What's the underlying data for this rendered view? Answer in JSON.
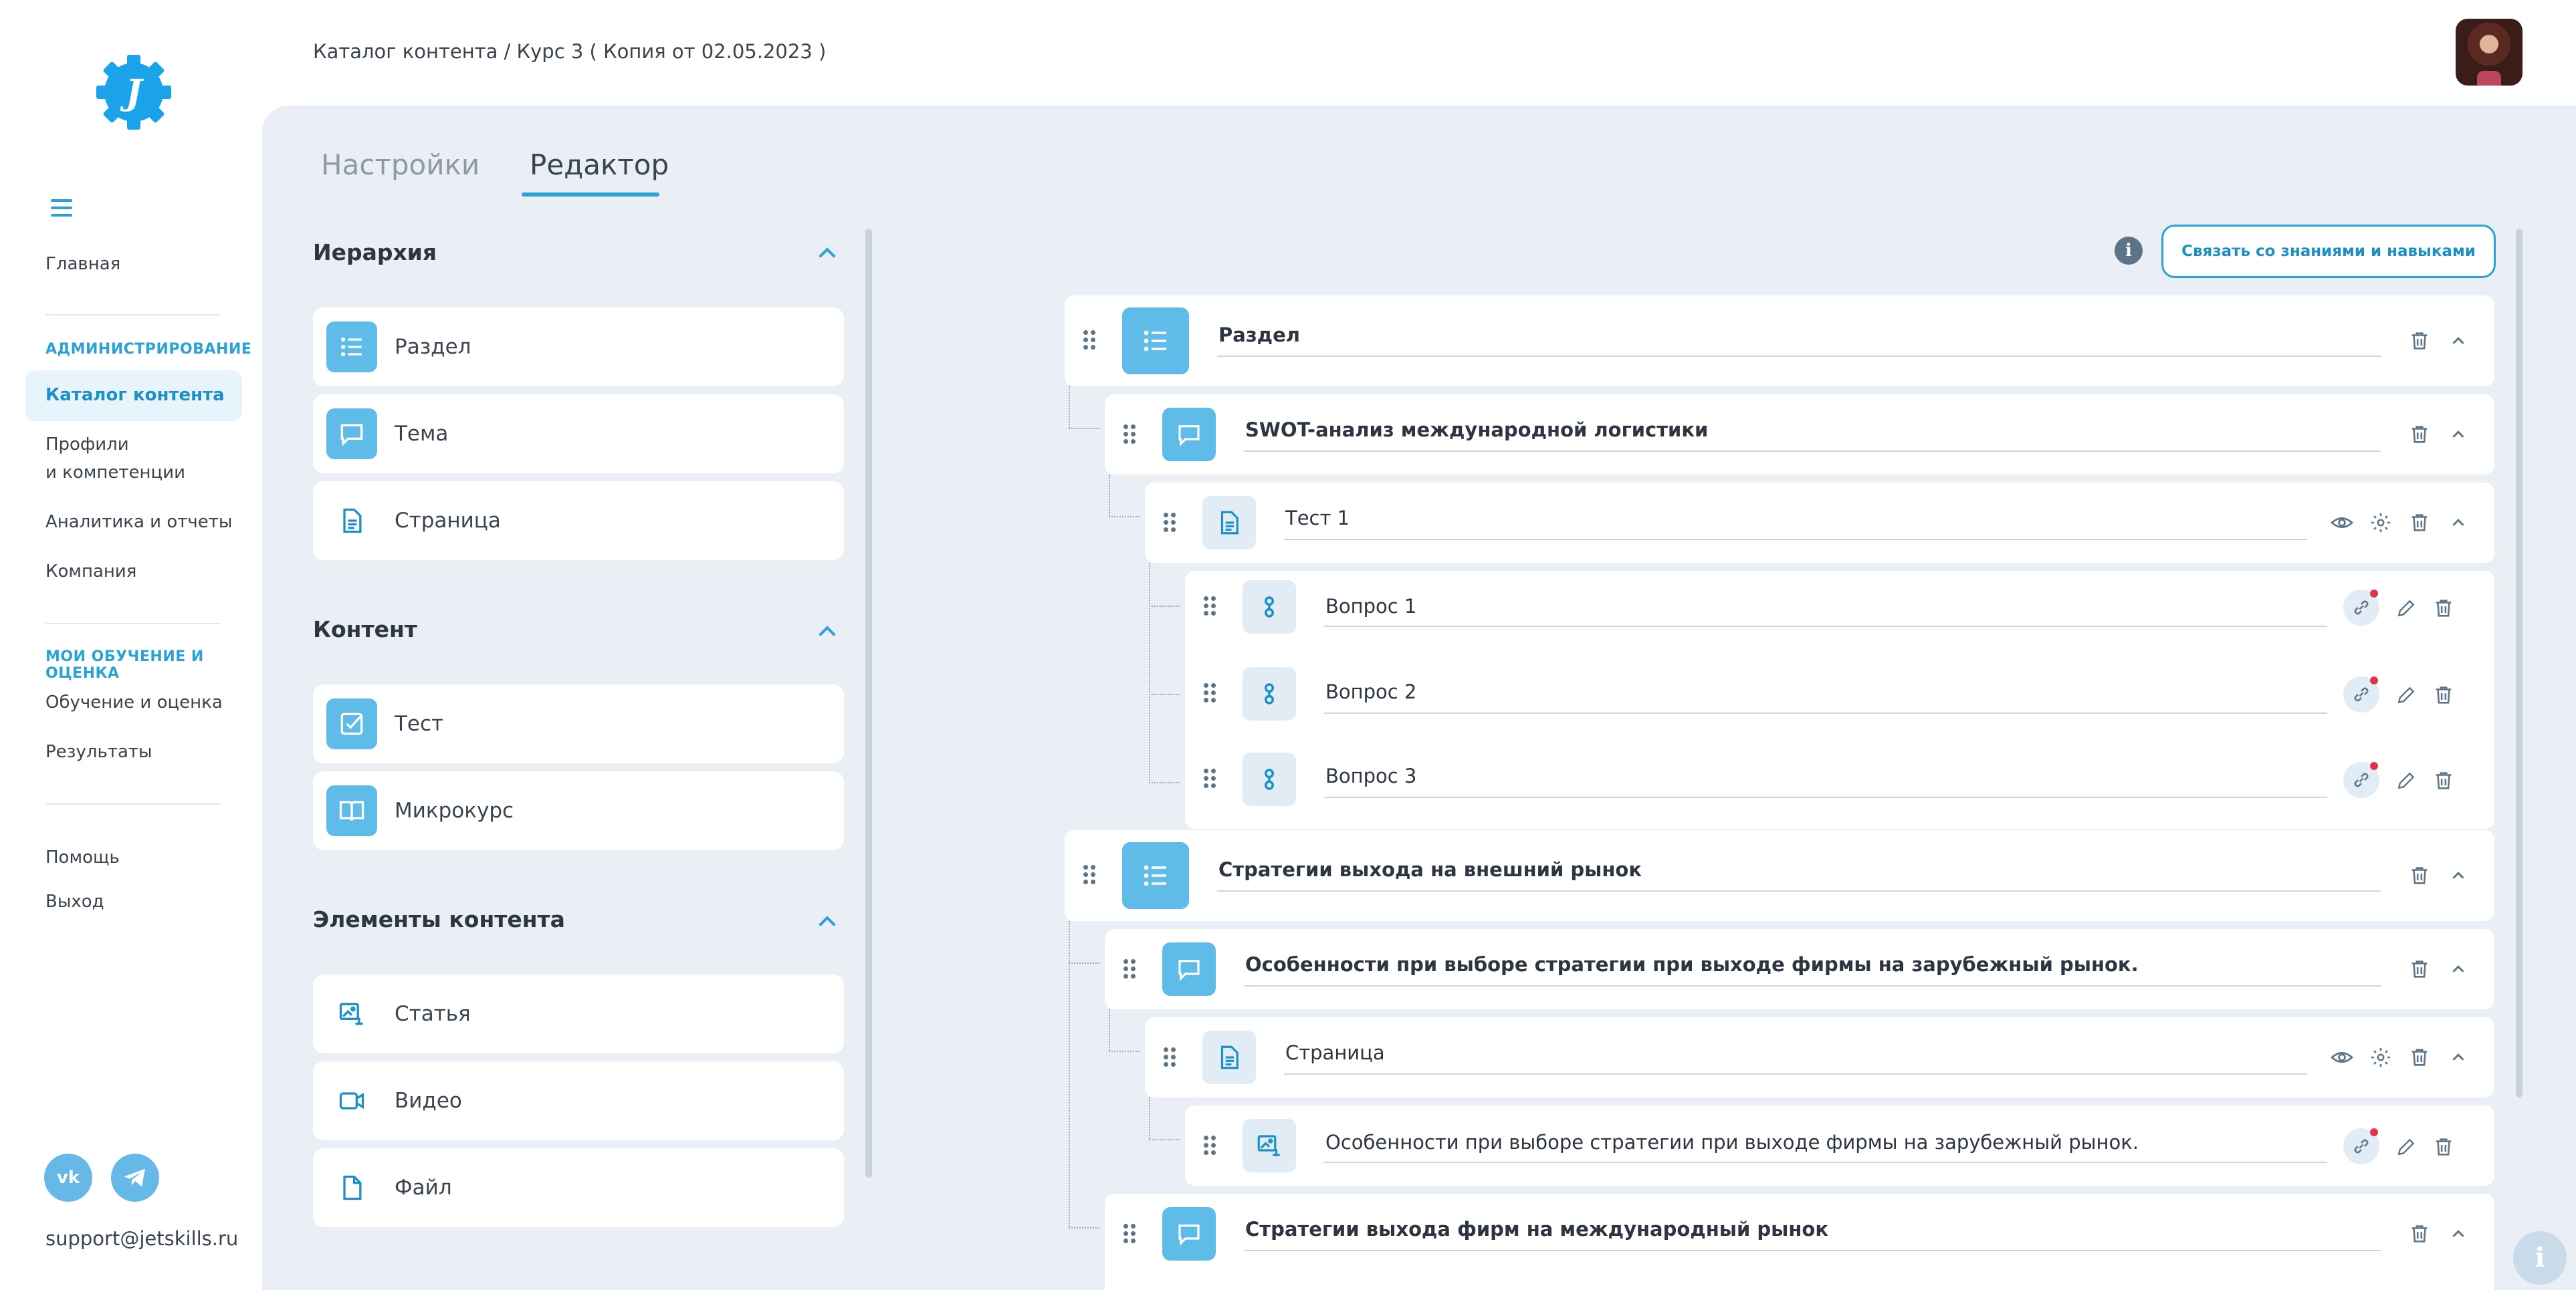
{
  "sidebar": {
    "home": "Главная",
    "section_admin": "АДМИНИСТРИРОВАНИЕ",
    "content_catalog": "Каталог контента",
    "profiles_line1": "Профили",
    "profiles_line2": "и компетенции",
    "analytics": "Аналитика и отчеты",
    "company": "Компания",
    "section_learning": "МОИ ОБУЧЕНИЕ И ОЦЕНКА",
    "learning": "Обучение и оценка",
    "results": "Результаты",
    "help": "Помощь",
    "logout": "Выход",
    "social": [
      {
        "icon": "vk-icon",
        "glyph": "vk"
      },
      {
        "icon": "telegram-icon"
      }
    ],
    "support_email": "support@jetskills.ru"
  },
  "header": {
    "breadcrumb": "Каталог контента / Курс 3 ( Копия от 02.05.2023 )"
  },
  "tabs": [
    {
      "label": "Настройки",
      "active": false
    },
    {
      "label": "Редактор",
      "active": true
    }
  ],
  "palette": {
    "hierarchy": {
      "title": "Иерархия",
      "items": [
        {
          "label": "Раздел",
          "icon": "list-icon"
        },
        {
          "label": "Тема",
          "icon": "chat-icon"
        },
        {
          "label": "Страница",
          "icon": "page-icon"
        }
      ]
    },
    "content": {
      "title": "Контент",
      "items": [
        {
          "label": "Тест",
          "icon": "checkbox-icon"
        },
        {
          "label": "Микрокурс",
          "icon": "book-icon"
        }
      ]
    },
    "elements": {
      "title": "Элементы контента",
      "items": [
        {
          "label": "Статья",
          "icon": "article-icon"
        },
        {
          "label": "Видео",
          "icon": "video-icon"
        },
        {
          "label": "Файл",
          "icon": "file-icon"
        }
      ]
    }
  },
  "toolbar": {
    "info": "i",
    "link_button": "Связать со знаниями и навыками"
  },
  "tree": [
    {
      "label": "Раздел",
      "type": "section"
    },
    {
      "label": "SWOT-анализ международной логистики",
      "type": "topic"
    },
    {
      "label": "Тест 1",
      "type": "page"
    },
    {
      "label": "Вопрос 1",
      "type": "question"
    },
    {
      "label": "Вопрос 2",
      "type": "question"
    },
    {
      "label": "Вопрос 3",
      "type": "question"
    },
    {
      "label": "Стратегии выхода на внешний рынок",
      "type": "section"
    },
    {
      "label": "Особенности при выборе стратегии при выходе фирмы на зарубежный рынок.",
      "type": "topic"
    },
    {
      "label": "Страница",
      "type": "page"
    },
    {
      "label": "Особенности при выборе стратегии при выходе фирмы на зарубежный рынок.",
      "type": "article"
    },
    {
      "label": "Стратегии выхода фирм на международный рынок",
      "type": "topic"
    }
  ],
  "help_fab": "i",
  "colors": {
    "accent": "#2aa2d6",
    "icon_fill": "#5fbbe8",
    "panel_bg": "#e9eff5",
    "notify_dot": "#e0334d"
  }
}
